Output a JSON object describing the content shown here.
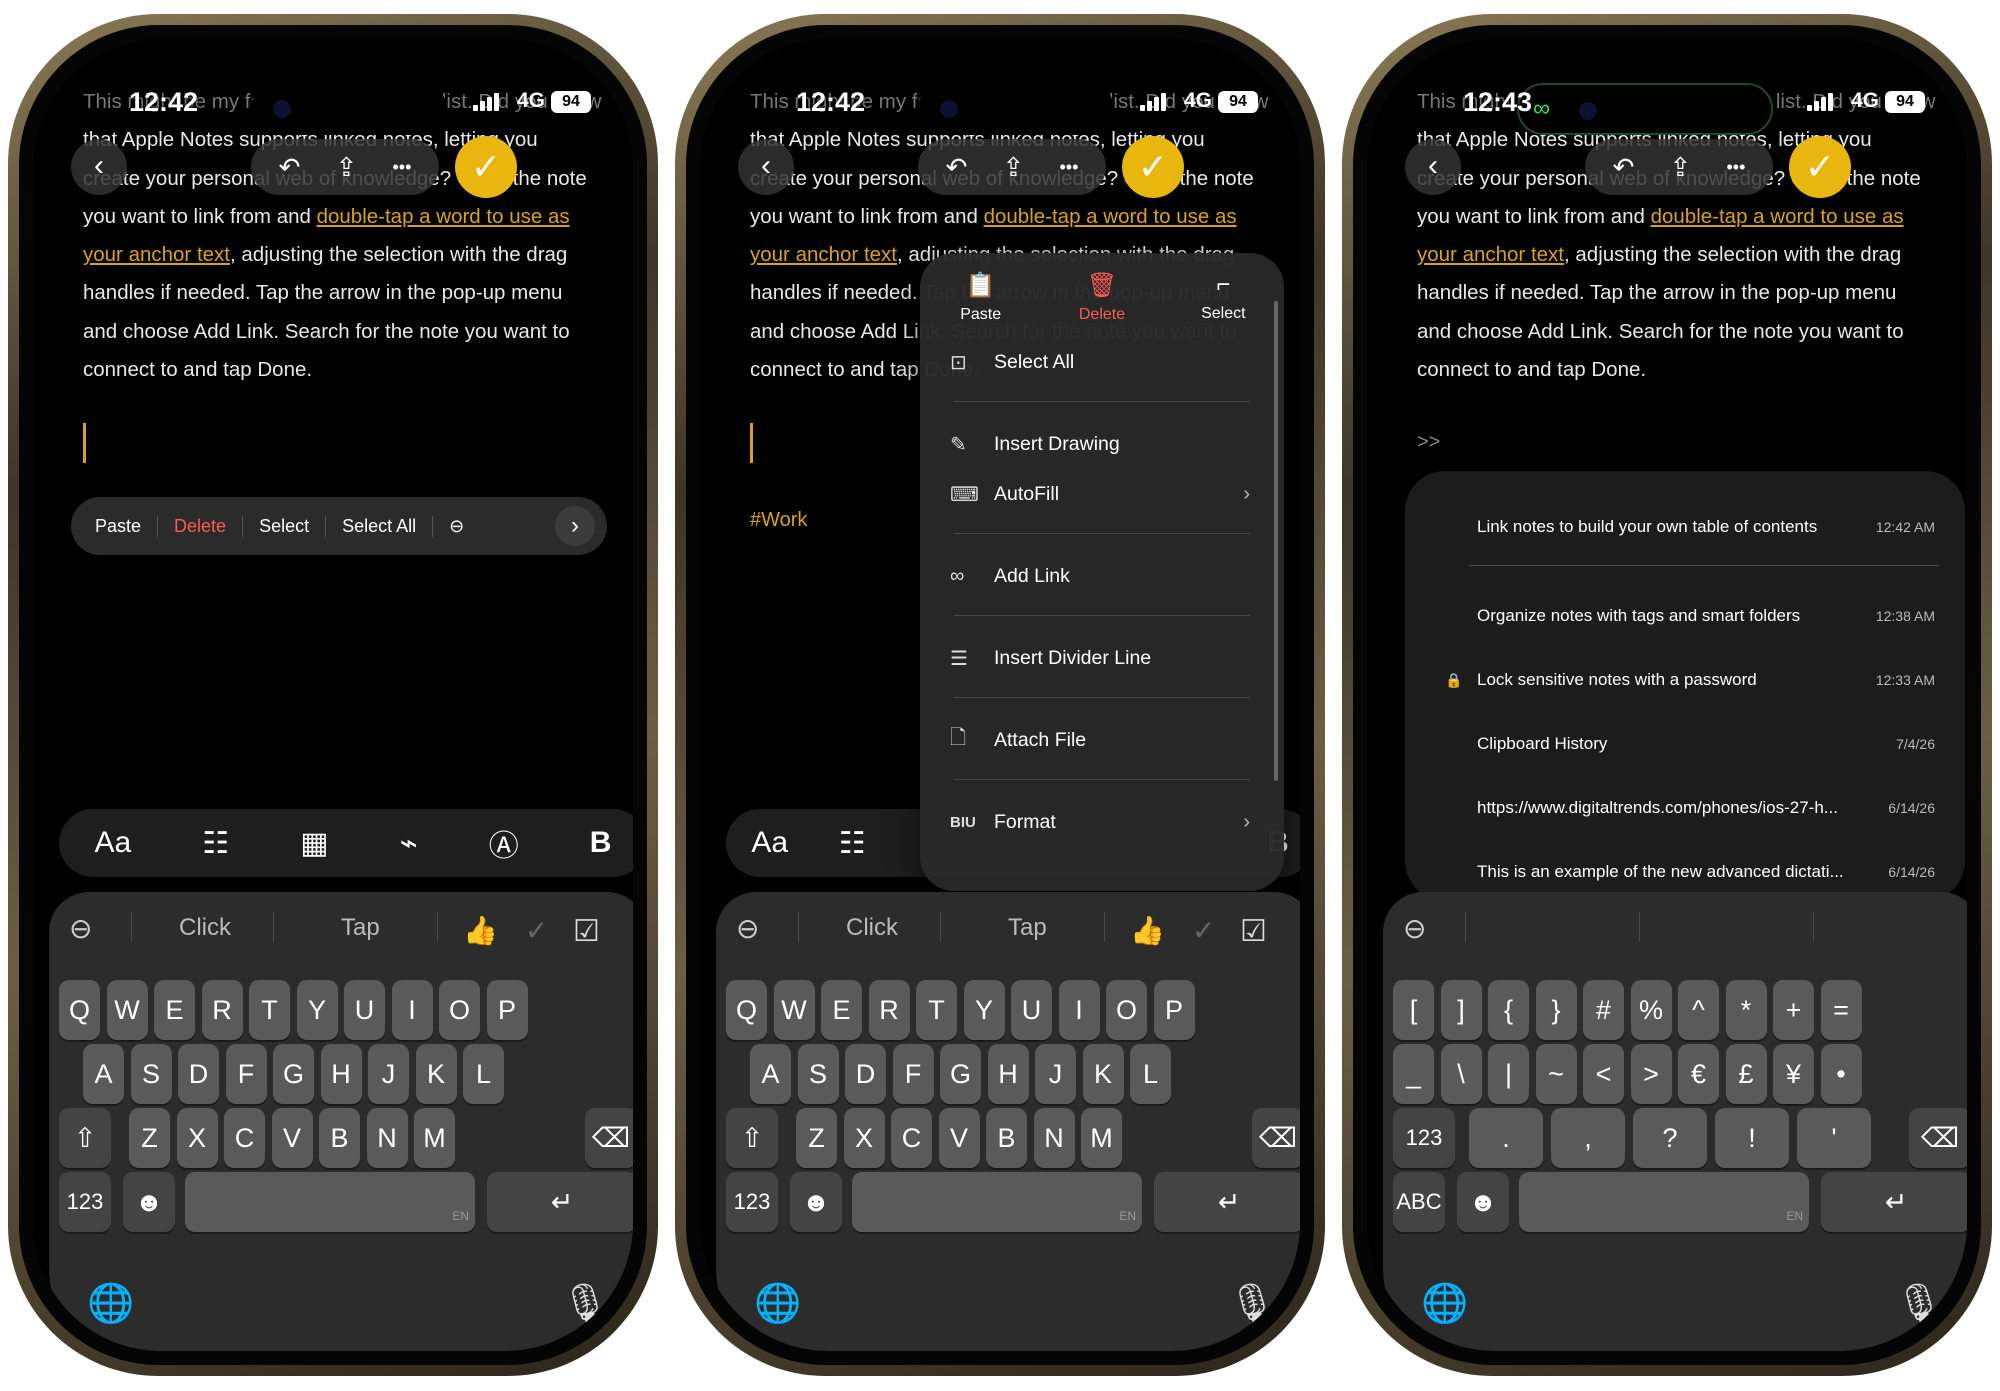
{
  "note": {
    "line1": "This might be my favorite feature in my list. Did you know",
    "line2": "that Apple Notes supports linked notes, letting you",
    "line3_pre": "create your personal web of knowledge? Open the note",
    "line4_pre": "you want to link from and ",
    "line4_link": "double-tap a word to use as",
    "line5_link": "your anchor text",
    "line5_post": ", adjusting the selection with the drag",
    "line6": "handles if needed. Tap the arrow in the pop-up menu",
    "line7": "and choose Add Link. Search for the note you want to",
    "line8": "connect to and tap Done.",
    "tag": "#Work",
    "link_prefix": ">>"
  },
  "status": {
    "time1": "12:42",
    "time2": "12:42",
    "time3": "12:43",
    "network": "4G",
    "battery": "94"
  },
  "nav": {
    "back_icon": "chevron-left",
    "undo_icon": "undo-arrow",
    "share_icon": "share",
    "more_icon": "ellipsis",
    "done_icon": "checkmark",
    "back_glyph": "‹",
    "undo_glyph": "↶",
    "share_glyph": "⇪",
    "more_glyph": "•••",
    "done_glyph": "✓"
  },
  "editbar": {
    "paste": "Paste",
    "delete": "Delete",
    "select": "Select",
    "select_all": "Select All",
    "more_glyph": "›"
  },
  "fmtbar": {
    "aa": "Aa",
    "checklist_glyph": "☷",
    "table_glyph": "▦",
    "attach_glyph": "⌁",
    "markup_glyph": "Ⓐ",
    "bold_glyph": "B"
  },
  "menu": {
    "paste": "Paste",
    "delete": "Delete",
    "select": "Select",
    "items": [
      {
        "label": "Select All",
        "icon": "select-all-icon",
        "glyph": "⊡"
      },
      {
        "label": "Insert Drawing",
        "icon": "drawing-icon",
        "glyph": "✎"
      },
      {
        "label": "AutoFill",
        "icon": "autofill-icon",
        "glyph": "⌨",
        "chevron": "›"
      },
      {
        "label": "Add Link",
        "icon": "link-icon",
        "glyph": "∞"
      },
      {
        "label": "Insert Divider Line",
        "icon": "divider-icon",
        "glyph": "☰"
      },
      {
        "label": "Attach File",
        "icon": "file-icon",
        "glyph": "🗋"
      },
      {
        "label": "Format",
        "icon": "format-icon",
        "glyph": "BIU",
        "chevron": "›"
      }
    ]
  },
  "links": [
    {
      "title": "Link notes to build your own table of contents",
      "date": "12:42 AM"
    },
    {
      "title": "Organize notes with tags and smart folders",
      "date": "12:38 AM"
    },
    {
      "title": "Lock sensitive notes with a password",
      "date": "12:33 AM",
      "locked": true
    },
    {
      "title": "Clipboard History",
      "date": "7/4/26"
    },
    {
      "title": "https://www.digitaltrends.com/phones/ios-27-h...",
      "date": "6/14/26"
    },
    {
      "title": "This is an example of the new advanced dictati...",
      "date": "6/14/26"
    }
  ],
  "keyboard": {
    "predictions": [
      "Click",
      "Tap"
    ],
    "pred_emoji": "👍",
    "pred_check": "✓",
    "pred_checkbox": "☑",
    "row1": [
      "Q",
      "W",
      "E",
      "R",
      "T",
      "Y",
      "U",
      "I",
      "O",
      "P"
    ],
    "row2": [
      "A",
      "S",
      "D",
      "F",
      "G",
      "H",
      "J",
      "K",
      "L"
    ],
    "row3": [
      "Z",
      "X",
      "C",
      "V",
      "B",
      "N",
      "M"
    ],
    "sym_row1": [
      "[",
      "]",
      "{",
      "}",
      "#",
      "%",
      "^",
      "*",
      "+",
      "="
    ],
    "sym_row2": [
      "_",
      "\\",
      "|",
      "~",
      "<",
      ">",
      "€",
      "£",
      "¥",
      "•"
    ],
    "sym_row3": [
      ".",
      ",",
      "?",
      "!",
      "'"
    ],
    "shift": "⇧",
    "backspace": "⌫",
    "numbers": "123",
    "abc": "ABC",
    "emoji": "☻",
    "return": "↵",
    "lang": "EN",
    "globe": "🌐",
    "mic": "🎙"
  }
}
